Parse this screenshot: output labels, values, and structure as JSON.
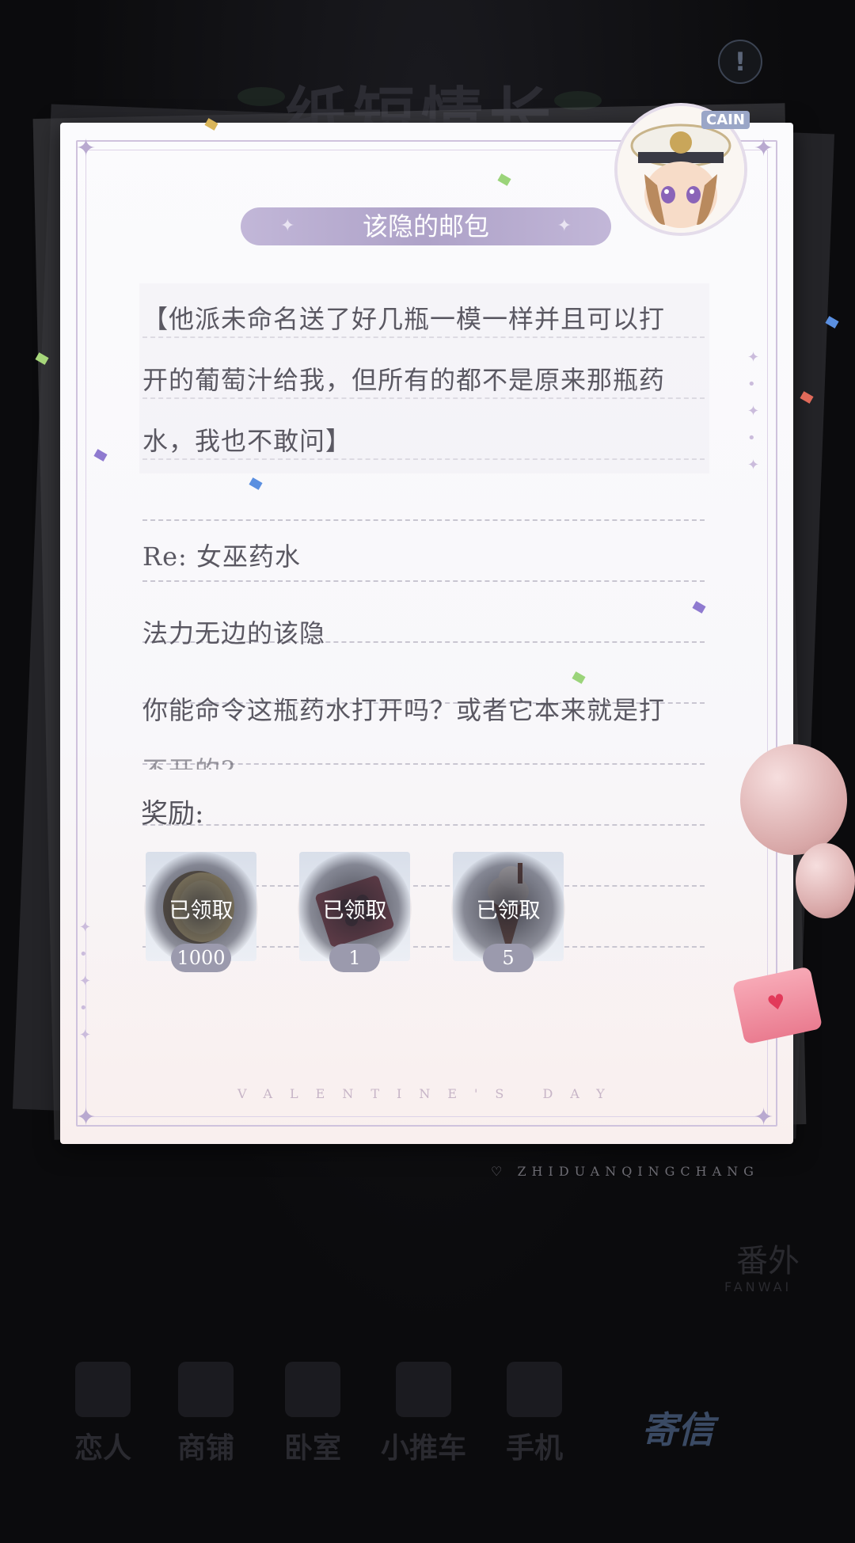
{
  "background": {
    "title_text": "纸短情长",
    "send_label": "寄信",
    "side_label": "番外",
    "side_sub": "FANWAI",
    "nav": [
      "恋人",
      "商铺",
      "卧室",
      "小推车",
      "手机"
    ]
  },
  "card": {
    "avatar_tag": "CAIN",
    "title": "该隐的邮包",
    "message_lines": [
      "【他派未命名送了好几瓶一模一样并且可以打",
      "开的葡萄汁给我，但所有的都不是原来那瓶药",
      "水，我也不敢问】"
    ],
    "reply_subject": "Re: 女巫药水",
    "reply_salutation": "法力无边的该隐",
    "reply_body_line1": "你能命令这瓶药水打开吗？或者它本来就是打",
    "reply_body_line2": "不开的?",
    "reward_label": "奖励:",
    "rewards": [
      {
        "name": "gold-coin",
        "status": "已领取",
        "quantity": "1000"
      },
      {
        "name": "chocolate-box",
        "status": "已领取",
        "quantity": "1"
      },
      {
        "name": "ice-cream",
        "status": "已领取",
        "quantity": "5"
      }
    ],
    "footer": "VALENTINE'S DAY"
  },
  "brand_footer": "ZHIDUANQINGCHANG",
  "colors": {
    "accent_lavender": "#aea2c8",
    "frame": "#cfc2dd",
    "text": "#5a5862",
    "qty_badge": "#9b9aad"
  }
}
